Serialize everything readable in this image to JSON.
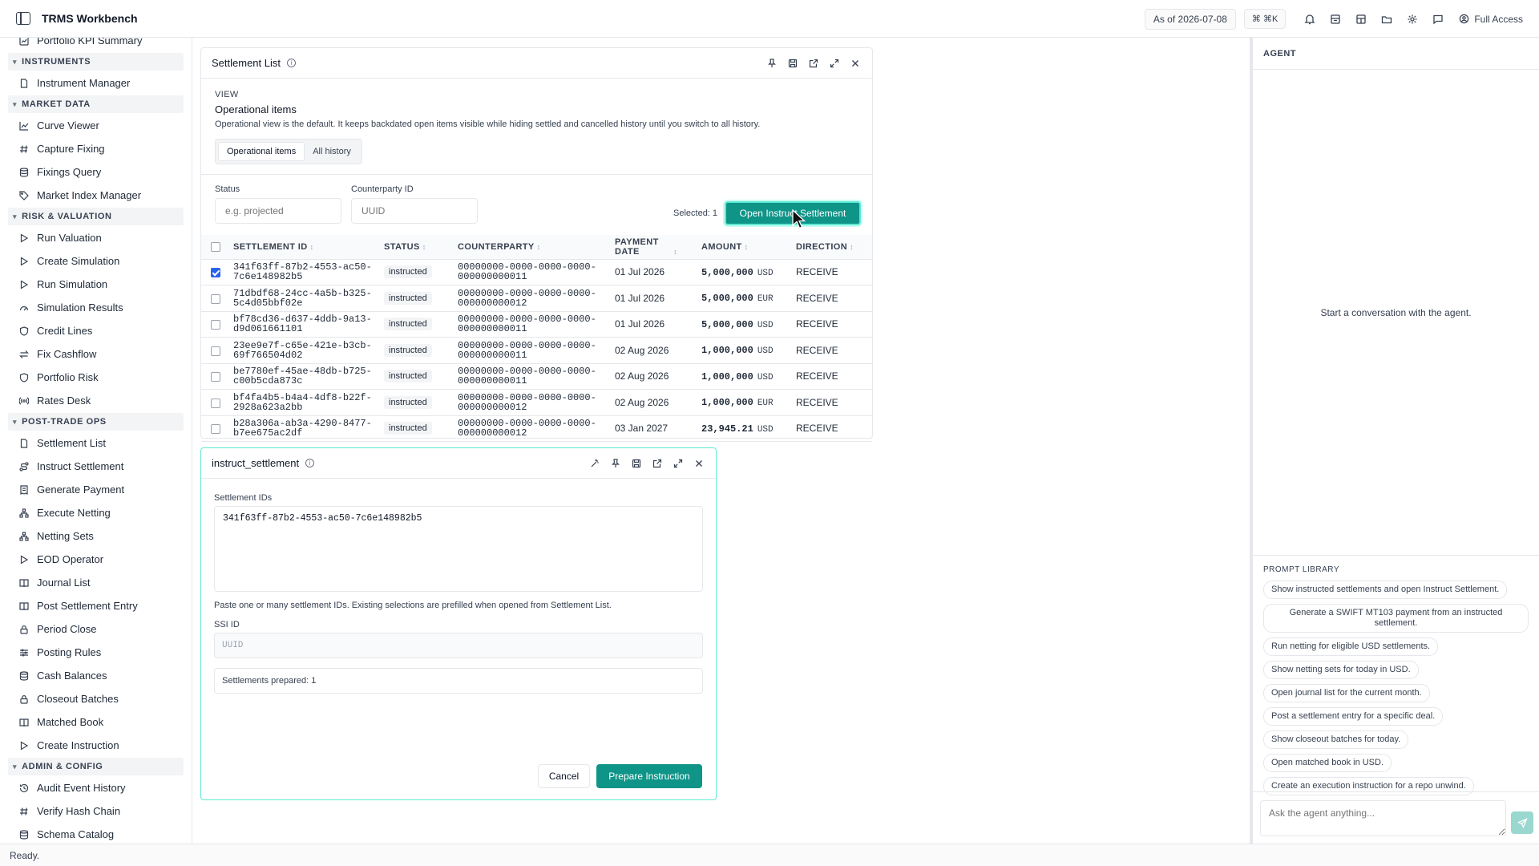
{
  "app": {
    "title": "TRMS Workbench",
    "as_of": "As of 2026-07-08",
    "shortcut": "⌘ ⌘K",
    "access": "Full Access"
  },
  "topbar_icons": [
    "panel-toggle-icon",
    "bell-icon",
    "archive-icon",
    "layout-icon",
    "folder-icon",
    "gear-icon",
    "chat-icon",
    "user-circle-icon"
  ],
  "sidebar": {
    "top_item": {
      "label": "Portfolio KPI Summary",
      "icon": "chart-icon"
    },
    "sections": [
      {
        "label": "INSTRUMENTS",
        "items": [
          {
            "label": "Instrument Manager",
            "icon": "doc-icon"
          }
        ]
      },
      {
        "label": "MARKET DATA",
        "items": [
          {
            "label": "Curve Viewer",
            "icon": "line-chart-icon"
          },
          {
            "label": "Capture Fixing",
            "icon": "hash-icon"
          },
          {
            "label": "Fixings Query",
            "icon": "database-icon"
          },
          {
            "label": "Market Index Manager",
            "icon": "tag-icon"
          }
        ]
      },
      {
        "label": "RISK & VALUATION",
        "items": [
          {
            "label": "Run Valuation",
            "icon": "play-icon"
          },
          {
            "label": "Create Simulation",
            "icon": "play-icon"
          },
          {
            "label": "Run Simulation",
            "icon": "play-icon"
          },
          {
            "label": "Simulation Results",
            "icon": "gauge-icon"
          },
          {
            "label": "Credit Lines",
            "icon": "shield-icon"
          },
          {
            "label": "Fix Cashflow",
            "icon": "swap-icon"
          },
          {
            "label": "Portfolio Risk",
            "icon": "shield-icon"
          },
          {
            "label": "Rates Desk",
            "icon": "radio-icon"
          }
        ]
      },
      {
        "label": "POST-TRADE OPS",
        "items": [
          {
            "label": "Settlement List",
            "icon": "doc-icon"
          },
          {
            "label": "Instruct Settlement",
            "icon": "route-icon"
          },
          {
            "label": "Generate Payment",
            "icon": "receipt-icon"
          },
          {
            "label": "Execute Netting",
            "icon": "network-icon"
          },
          {
            "label": "Netting Sets",
            "icon": "network-icon"
          },
          {
            "label": "EOD Operator",
            "icon": "play-icon"
          },
          {
            "label": "Journal List",
            "icon": "book-icon"
          },
          {
            "label": "Post Settlement Entry",
            "icon": "book-icon"
          },
          {
            "label": "Period Close",
            "icon": "lock-icon"
          },
          {
            "label": "Posting Rules",
            "icon": "sliders-icon"
          },
          {
            "label": "Cash Balances",
            "icon": "database-icon"
          },
          {
            "label": "Closeout Batches",
            "icon": "lock-icon"
          },
          {
            "label": "Matched Book",
            "icon": "book-icon"
          },
          {
            "label": "Create Instruction",
            "icon": "play-icon"
          }
        ]
      },
      {
        "label": "ADMIN & CONFIG",
        "items": [
          {
            "label": "Audit Event History",
            "icon": "history-icon"
          },
          {
            "label": "Verify Hash Chain",
            "icon": "hash-icon"
          },
          {
            "label": "Schema Catalog",
            "icon": "database-icon"
          }
        ]
      }
    ]
  },
  "settlement_list": {
    "title": "Settlement List",
    "view_label": "VIEW",
    "view_title": "Operational items",
    "view_desc": "Operational view is the default. It keeps backdated open items visible while hiding settled and cancelled history until you switch to all history.",
    "tabs": [
      "Operational items",
      "All history"
    ],
    "status_label": "Status",
    "status_placeholder": "e.g. projected",
    "counterparty_label": "Counterparty ID",
    "counterparty_placeholder": "UUID",
    "selected": "Selected: 1",
    "open_button": "Open Instruct Settlement",
    "columns": [
      "SETTLEMENT ID",
      "STATUS",
      "COUNTERPARTY",
      "PAYMENT DATE",
      "AMOUNT",
      "DIRECTION"
    ],
    "rows": [
      {
        "checked": true,
        "id1": "341f63ff-87b2-4553-ac50-",
        "id2": "7c6e148982b5",
        "status": "instructed",
        "cp1": "00000000-0000-0000-0000-",
        "cp2": "000000000011",
        "date": "01 Jul 2026",
        "amount": "5,000,000",
        "ccy": "USD",
        "direction": "RECEIVE"
      },
      {
        "checked": false,
        "id1": "71dbdf68-24cc-4a5b-b325-",
        "id2": "5c4d05bbf02e",
        "status": "instructed",
        "cp1": "00000000-0000-0000-0000-",
        "cp2": "000000000012",
        "date": "01 Jul 2026",
        "amount": "5,000,000",
        "ccy": "EUR",
        "direction": "RECEIVE"
      },
      {
        "checked": false,
        "id1": "bf78cd36-d637-4ddb-9a13-",
        "id2": "d9d061661101",
        "status": "instructed",
        "cp1": "00000000-0000-0000-0000-",
        "cp2": "000000000011",
        "date": "01 Jul 2026",
        "amount": "5,000,000",
        "ccy": "USD",
        "direction": "RECEIVE"
      },
      {
        "checked": false,
        "id1": "23ee9e7f-c65e-421e-b3cb-",
        "id2": "69f766504d02",
        "status": "instructed",
        "cp1": "00000000-0000-0000-0000-",
        "cp2": "000000000011",
        "date": "02 Aug 2026",
        "amount": "1,000,000",
        "ccy": "USD",
        "direction": "RECEIVE"
      },
      {
        "checked": false,
        "id1": "be7780ef-45ae-48db-b725-",
        "id2": "c00b5cda873c",
        "status": "instructed",
        "cp1": "00000000-0000-0000-0000-",
        "cp2": "000000000011",
        "date": "02 Aug 2026",
        "amount": "1,000,000",
        "ccy": "USD",
        "direction": "RECEIVE"
      },
      {
        "checked": false,
        "id1": "bf4fa4b5-b4a4-4df8-b22f-",
        "id2": "2928a623a2bb",
        "status": "instructed",
        "cp1": "00000000-0000-0000-0000-",
        "cp2": "000000000012",
        "date": "02 Aug 2026",
        "amount": "1,000,000",
        "ccy": "EUR",
        "direction": "RECEIVE"
      },
      {
        "checked": false,
        "id1": "b28a306a-ab3a-4290-8477-",
        "id2": "b7ee675ac2df",
        "status": "instructed",
        "cp1": "00000000-0000-0000-0000-",
        "cp2": "000000000012",
        "date": "03 Jan 2027",
        "amount": "23,945.21",
        "ccy": "USD",
        "direction": "RECEIVE"
      }
    ]
  },
  "instruct": {
    "title": "instruct_settlement",
    "ids_label": "Settlement IDs",
    "ids_value": "341f63ff-87b2-4553-ac50-7c6e148982b5",
    "hint": "Paste one or many settlement IDs. Existing selections are prefilled when opened from Settlement List.",
    "ssi_label": "SSI ID",
    "ssi_placeholder": "UUID",
    "prepared": "Settlements prepared: 1",
    "cancel": "Cancel",
    "prepare": "Prepare Instruction"
  },
  "agent": {
    "title": "AGENT",
    "empty": "Start a conversation with the agent.",
    "library_title": "PROMPT LIBRARY",
    "prompts": [
      "Show instructed settlements and open Instruct Settlement.",
      "Generate a SWIFT MT103 payment from an instructed settlement.",
      "Run netting for eligible USD settlements.",
      "Show netting sets for today in USD.",
      "Open journal list for the current month.",
      "Post a settlement entry for a specific deal.",
      "Show closeout batches for today.",
      "Open matched book in USD.",
      "Create an execution instruction for a repo unwind."
    ],
    "input_placeholder": "Ask the agent anything..."
  },
  "status": "Ready.",
  "colors": {
    "accent": "#0f9488",
    "focus": "#5eead4"
  }
}
